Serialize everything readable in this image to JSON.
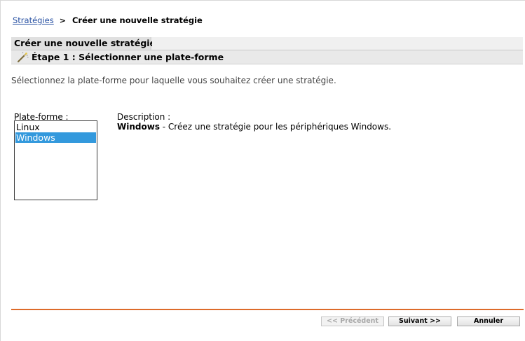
{
  "breadcrumb": {
    "parent_label": "Stratégies",
    "separator": ">",
    "current_label": "Créer une nouvelle stratégie"
  },
  "wizard": {
    "tab_label": "Créer une nouvelle stratégie",
    "step_label": "Étape 1 : Sélectionner une plate-forme",
    "step_icon": "wizard-wand-icon",
    "instruction": "Sélectionnez la plate-forme pour laquelle vous souhaitez créer une stratégie."
  },
  "platform": {
    "label": "Plate-forme :",
    "options": [
      {
        "label": "Linux",
        "selected": false
      },
      {
        "label": "Windows",
        "selected": true
      }
    ]
  },
  "description": {
    "label": "Description :",
    "name": "Windows",
    "text": " - Créez une stratégie pour les périphériques Windows."
  },
  "buttons": {
    "previous_label": "<< Précédent",
    "next_label": "Suivant >>",
    "cancel_label": "Annuler"
  },
  "colors": {
    "link": "#2952a3",
    "selection": "#3399dd",
    "divider": "#dd6b2a"
  }
}
